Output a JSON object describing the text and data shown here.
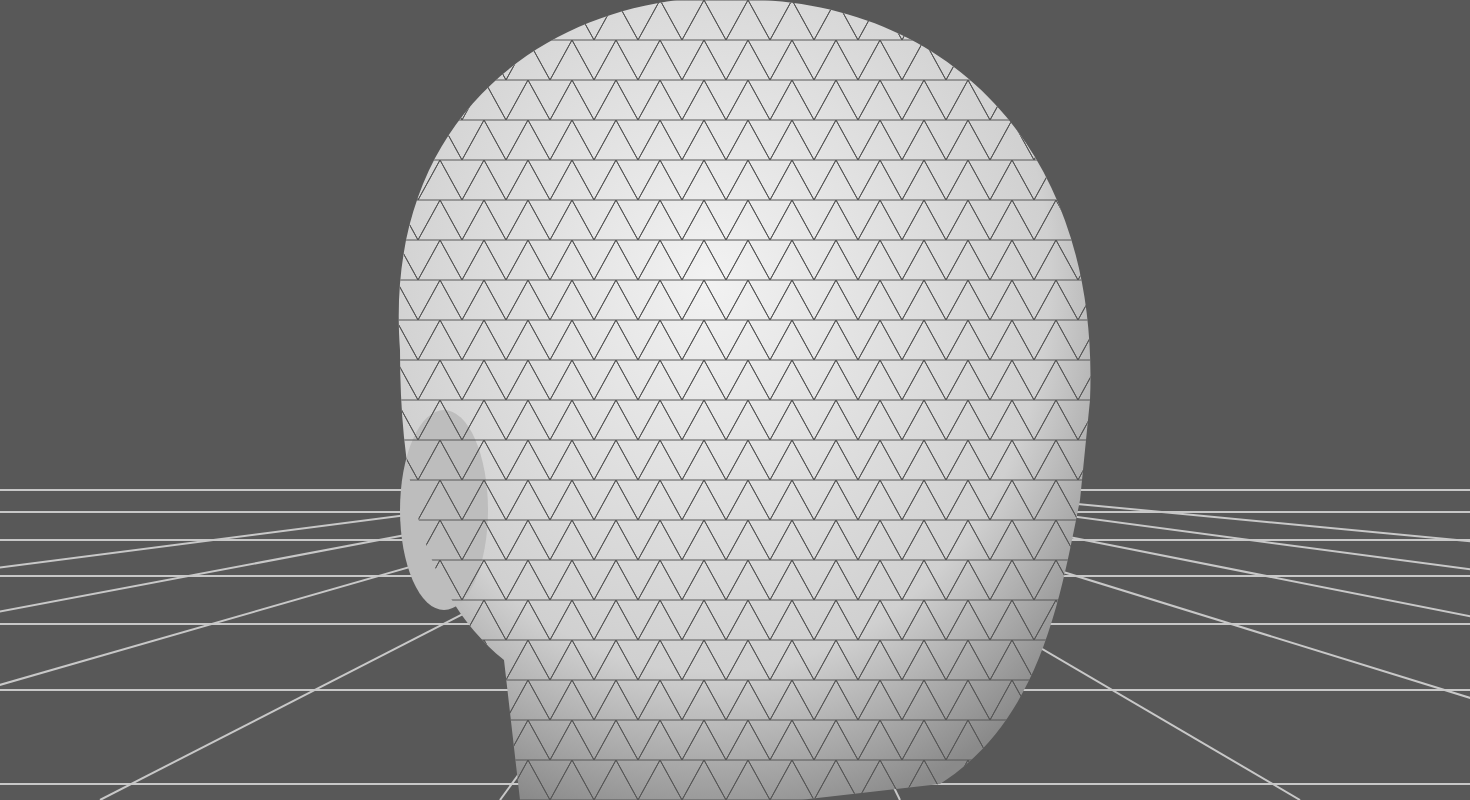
{
  "viewport": {
    "show_grid": true,
    "model": {
      "kind": "head",
      "wireframe": true
    }
  }
}
